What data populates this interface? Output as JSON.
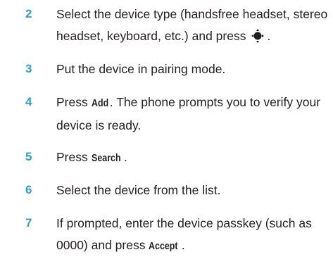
{
  "steps": [
    {
      "number": "2",
      "line1": "Select the device type (handsfree headset, stereo",
      "line2_prefix": "headset, keyboard, etc.) and press",
      "line2_suffix": ".",
      "icon": "nav-key-icon"
    },
    {
      "number": "3",
      "text": "Put the device in pairing mode."
    },
    {
      "number": "4",
      "line1_prefix": "Press",
      "line1_keyword": "Add",
      "line1_suffix": ". The phone prompts you to verify your",
      "line2": "device is ready."
    },
    {
      "number": "5",
      "prefix": "Press",
      "keyword": "Search",
      "suffix": "."
    },
    {
      "number": "6",
      "text": "Select the device from the list."
    },
    {
      "number": "7",
      "line1": "If prompted, enter the device passkey (such as",
      "line2_prefix": "0000) and press",
      "line2_keyword": "Accept",
      "line2_suffix": "."
    }
  ],
  "colors": {
    "step_number": "#2b9fd6",
    "body_text": "#231f20"
  }
}
